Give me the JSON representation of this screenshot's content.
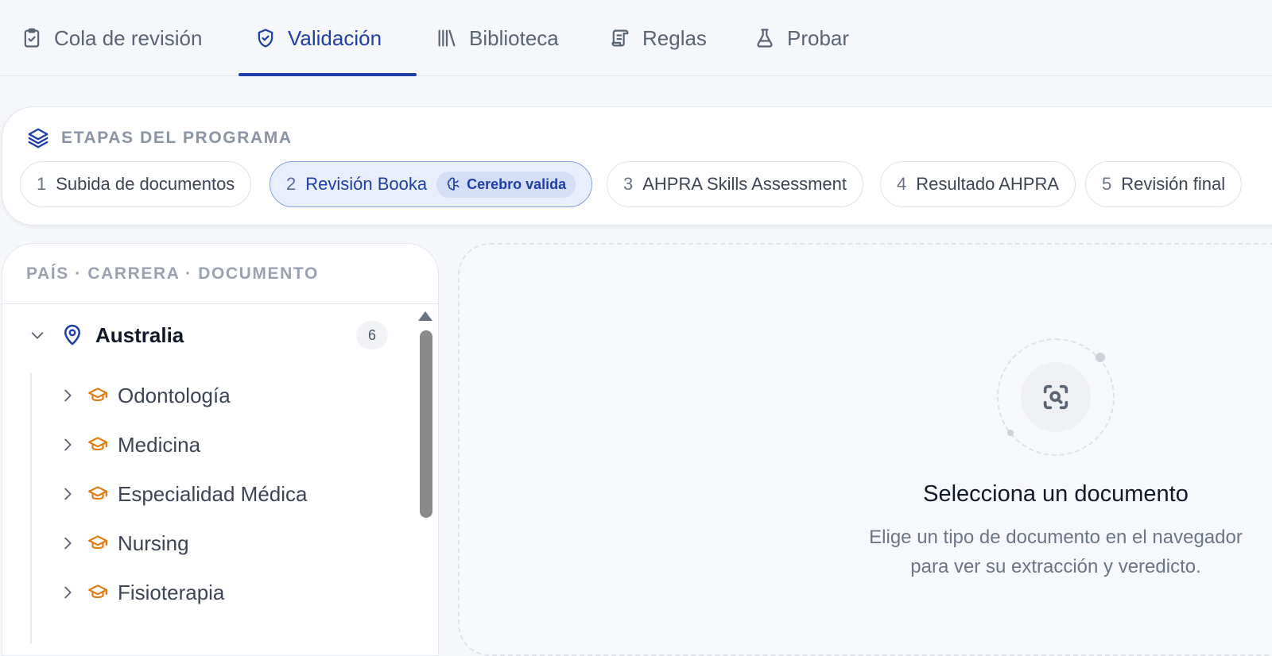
{
  "tabs": [
    {
      "label": "Cola de revisión",
      "icon": "clipboard-check-icon",
      "active": false
    },
    {
      "label": "Validación",
      "icon": "shield-check-icon",
      "active": true
    },
    {
      "label": "Biblioteca",
      "icon": "library-icon",
      "active": false
    },
    {
      "label": "Reglas",
      "icon": "scroll-icon",
      "active": false
    },
    {
      "label": "Probar",
      "icon": "flask-icon",
      "active": false
    }
  ],
  "stages": {
    "title": "ETAPAS DEL PROGRAMA",
    "items": [
      {
        "num": "1",
        "label": "Subida de documentos"
      },
      {
        "num": "2",
        "label": "Revisión Booka",
        "badge": "Cerebro valida",
        "active": true
      },
      {
        "num": "3",
        "label": "AHPRA Skills Assessment"
      },
      {
        "num": "4",
        "label": "Resultado AHPRA"
      },
      {
        "num": "5",
        "label": "Revisión final"
      }
    ]
  },
  "navigator": {
    "header": "PAÍS · CARRERA · DOCUMENTO",
    "country": {
      "label": "Australia",
      "count": "6",
      "expanded": true
    },
    "careers": [
      "Odontología",
      "Medicina",
      "Especialidad Médica",
      "Nursing",
      "Fisioterapia"
    ]
  },
  "empty_state": {
    "title": "Selecciona un documento",
    "line1": "Elige un tipo de documento en el navegador",
    "line2": "para ver su extracción y veredicto."
  },
  "colors": {
    "accent": "#1e3fa8",
    "career_icon": "#e07b12",
    "background": "#f5f7fa"
  }
}
